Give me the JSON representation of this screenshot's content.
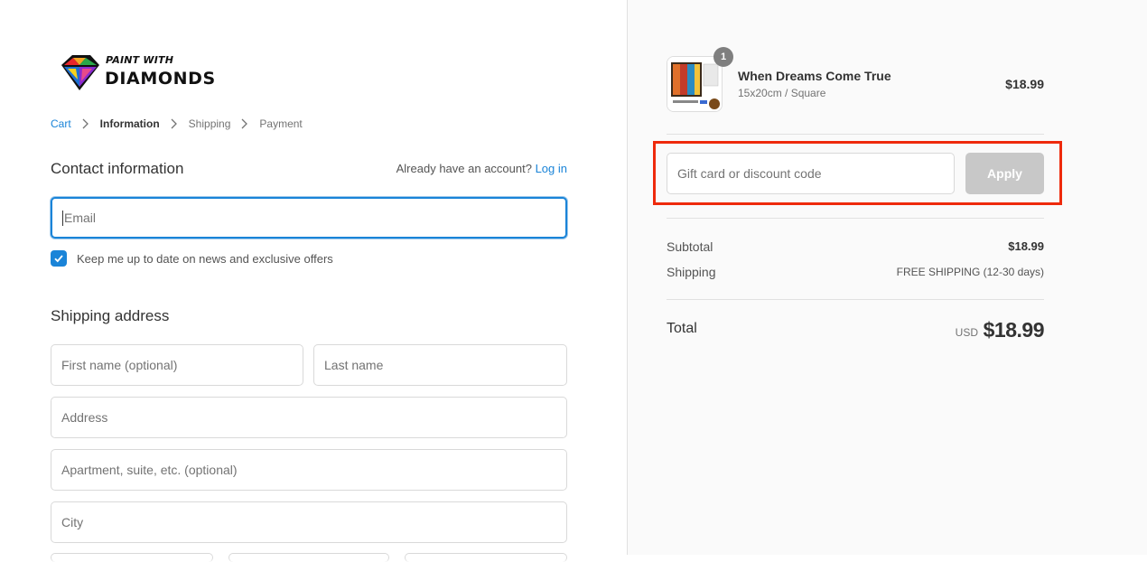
{
  "brand": {
    "line1": "PAINT WITH",
    "line2": "DIAMONDS"
  },
  "breadcrumb": {
    "cart": "Cart",
    "information": "Information",
    "shipping": "Shipping",
    "payment": "Payment"
  },
  "contact": {
    "title": "Contact information",
    "account_prompt": "Already have an account?",
    "login_link": "Log in",
    "email_placeholder": "Email",
    "newsletter_label": "Keep me up to date on news and exclusive offers",
    "newsletter_checked": true
  },
  "shipping_address": {
    "title": "Shipping address",
    "first_name_placeholder": "First name (optional)",
    "last_name_placeholder": "Last name",
    "address_placeholder": "Address",
    "apartment_placeholder": "Apartment, suite, etc. (optional)",
    "city_placeholder": "City"
  },
  "order_summary": {
    "item": {
      "quantity": "1",
      "name": "When Dreams Come True",
      "variant": "15x20cm / Square",
      "price": "$18.99"
    },
    "discount": {
      "placeholder": "Gift card or discount code",
      "apply_label": "Apply"
    },
    "subtotal_label": "Subtotal",
    "subtotal_value": "$18.99",
    "shipping_label": "Shipping",
    "shipping_value": "FREE SHIPPING (12-30 days)",
    "total_label": "Total",
    "currency": "USD",
    "total_value": "$18.99"
  },
  "colors": {
    "accent": "#1a84d8",
    "highlight": "#ee2a0c",
    "apply_disabled": "#c8c8c8"
  }
}
